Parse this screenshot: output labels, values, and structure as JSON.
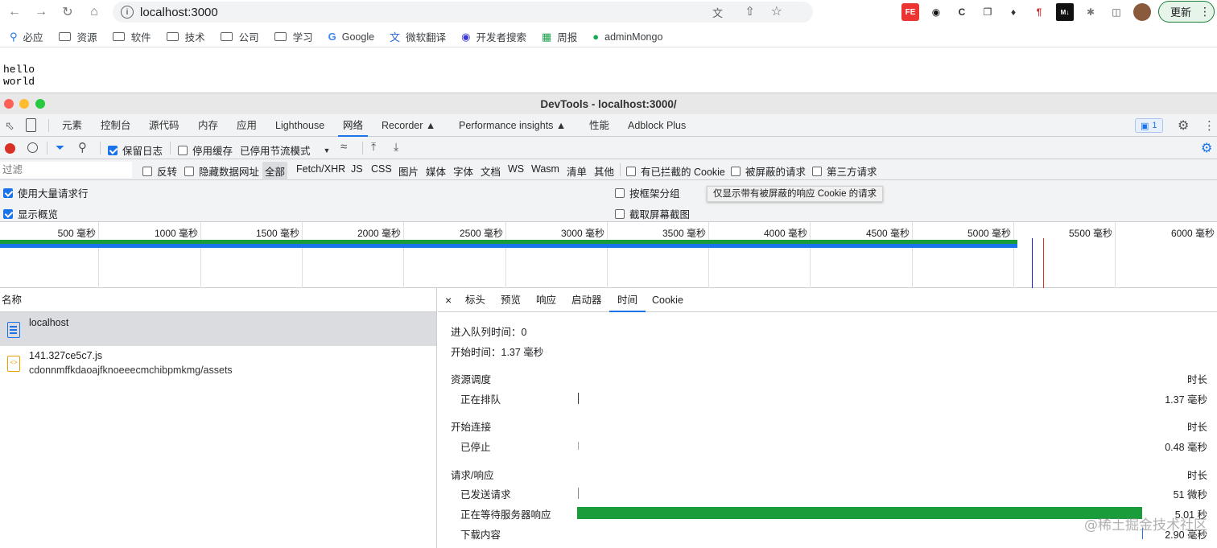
{
  "browser": {
    "url": "localhost:3000",
    "update_label": "更新",
    "bookmarks": [
      {
        "label": "必应",
        "icon": "search-icon"
      },
      {
        "label": "资源",
        "icon": "folder-icon"
      },
      {
        "label": "软件",
        "icon": "folder-icon"
      },
      {
        "label": "技术",
        "icon": "folder-icon"
      },
      {
        "label": "公司",
        "icon": "folder-icon"
      },
      {
        "label": "学习",
        "icon": "folder-icon"
      },
      {
        "label": "Google",
        "icon": "google-icon"
      },
      {
        "label": "微软翻译",
        "icon": "translate-icon"
      },
      {
        "label": "开发者搜索",
        "icon": "dev-search-icon"
      },
      {
        "label": "周报",
        "icon": "calendar-icon"
      },
      {
        "label": "adminMongo",
        "icon": "mongo-leaf-icon"
      }
    ]
  },
  "page": {
    "line1": "hello",
    "line2": "world"
  },
  "devtools": {
    "title": "DevTools - localhost:3000/",
    "tabs": [
      "元素",
      "控制台",
      "源代码",
      "内存",
      "应用",
      "Lighthouse",
      "网络",
      "Recorder",
      "Performance insights",
      "性能",
      "Adblock Plus"
    ],
    "active_tab": "网络",
    "issues_count": "1",
    "toolbar": {
      "preserve_log": "保留日志",
      "disable_cache": "停用缓存",
      "throttling": "已停用节流模式"
    },
    "filter": {
      "placeholder": "过滤",
      "invert": "反转",
      "hide_data_urls": "隐藏数据网址",
      "types": [
        "全部",
        "Fetch/XHR",
        "JS",
        "CSS",
        "图片",
        "媒体",
        "字体",
        "文档",
        "WS",
        "Wasm",
        "清单",
        "其他"
      ],
      "blocked_cookies": "有已拦截的 Cookie",
      "blocked_requests": "被屏蔽的请求",
      "third_party": "第三方请求"
    },
    "settings": {
      "large_rows": "使用大量请求行",
      "show_overview": "显示概览",
      "group_by_frame": "按框架分组",
      "capture_screenshots": "截取屏幕截图"
    },
    "tooltip": "仅显示带有被屏蔽的响应 Cookie 的请求",
    "overview_ticks": [
      "500 毫秒",
      "1000 毫秒",
      "1500 毫秒",
      "2000 毫秒",
      "2500 毫秒",
      "3000 毫秒",
      "3500 毫秒",
      "4000 毫秒",
      "4500 毫秒",
      "5000 毫秒",
      "5500 毫秒",
      "6000 毫秒"
    ],
    "request_list": {
      "header": "名称",
      "rows": [
        {
          "name": "localhost",
          "path": ""
        },
        {
          "name": "141.327ce5c7.js",
          "path": "cdonnmffkdaoajfknoeeecmchibpmkmg/assets"
        }
      ]
    },
    "details": {
      "tabs": [
        "标头",
        "预览",
        "响应",
        "启动器",
        "时间",
        "Cookie"
      ],
      "active_tab": "时间",
      "queued_at": "进入队列时间：0",
      "started_at": "开始时间：1.37 毫秒",
      "duration_header": "时长",
      "sections": [
        {
          "title": "资源调度",
          "rows": [
            {
              "label": "正在排队",
              "value": "1.37 毫秒"
            }
          ]
        },
        {
          "title": "开始连接",
          "rows": [
            {
              "label": "已停止",
              "value": "0.48 毫秒"
            }
          ]
        },
        {
          "title": "请求/响应",
          "rows": [
            {
              "label": "已发送请求",
              "value": "51 微秒"
            },
            {
              "label": "正在等待服务器响应",
              "value": "5.01 秒"
            },
            {
              "label": "下载内容",
              "value": "2.90 毫秒"
            }
          ]
        }
      ]
    }
  },
  "watermark": "@稀土掘金技术社区",
  "colors": {
    "accent": "#1a73e8",
    "waiting_bar": "#1a9c3b",
    "record": "#d93025"
  }
}
